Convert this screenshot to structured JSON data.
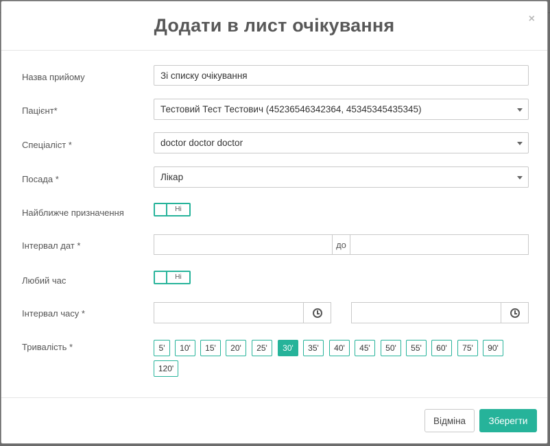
{
  "modal": {
    "title": "Додати в лист очікування",
    "close": "×"
  },
  "form": {
    "name": {
      "label": "Назва прийому",
      "value": "Зі списку очікування"
    },
    "patient": {
      "label": "Пацієнт*",
      "value": "Тестовий Тест Тестович (45236546342364, 45345345435345)"
    },
    "specialist": {
      "label": "Спеціаліст *",
      "value": "doctor doctor doctor"
    },
    "position": {
      "label": "Посада *",
      "value": "Лікар"
    },
    "nearest": {
      "label": "Найближче призначення",
      "toggle_text": "Ні"
    },
    "date_interval": {
      "label": "Інтервал дат *",
      "separator": "до",
      "from": "",
      "to": ""
    },
    "any_time": {
      "label": "Любий час",
      "toggle_text": "Ні"
    },
    "time_interval": {
      "label": "Інтервал часу *",
      "from": "",
      "to": ""
    },
    "duration": {
      "label": "Тривалість *",
      "options": [
        "5'",
        "10'",
        "15'",
        "20'",
        "25'",
        "30'",
        "35'",
        "40'",
        "45'",
        "50'",
        "55'",
        "60'",
        "75'",
        "90'",
        "120'"
      ],
      "selected": "30'"
    }
  },
  "footer": {
    "cancel_label": "Відміна",
    "save_label": "Зберегти"
  },
  "colors": {
    "accent": "#26b39a"
  },
  "icons": {
    "time_picker": "clock-icon",
    "dropdown": "chevron-down-icon",
    "close": "close-icon"
  }
}
